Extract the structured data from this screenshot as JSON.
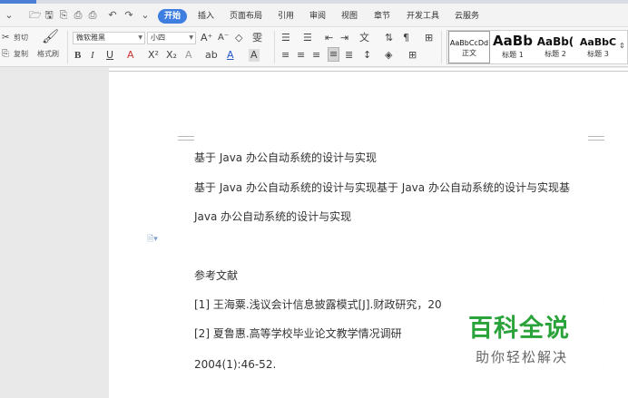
{
  "menubar": {
    "items": [
      "开始",
      "插入",
      "页面布局",
      "引用",
      "审阅",
      "视图",
      "章节",
      "开发工具",
      "云服务"
    ],
    "active_index": 0,
    "quick_icons": [
      "undo-dropdown-icon",
      "open-icon",
      "save-icon",
      "save-as-icon",
      "print-preview-icon",
      "print-icon",
      "undo-icon",
      "redo-icon",
      "customize-icon"
    ]
  },
  "ribbon": {
    "cut_label": "剪切",
    "copy_label": "复制",
    "format_painter_label": "格式刷",
    "font_name": "微软雅黑",
    "font_size": "小四",
    "bold": "B",
    "italic": "I",
    "underline": "U",
    "styles": [
      {
        "preview": "AaBbCcDd",
        "label": "正文"
      },
      {
        "preview": "AaBb",
        "label": "标题 1"
      },
      {
        "preview": "AaBb(",
        "label": "标题 2"
      },
      {
        "preview": "AaBbC",
        "label": "标题 3"
      }
    ]
  },
  "document": {
    "lines": [
      "基于 Java 办公自动系统的设计与实现",
      "基于 Java 办公自动系统的设计与实现基于 Java 办公自动系统的设计与实现基",
      "Java 办公自动系统的设计与实现",
      "参考文献",
      "[1]  王海粟.浅议会计信息披露模式[J].财政研究，20",
      "[2]  夏鲁惠.高等学校毕业论文教学情况调研",
      "2004(1):46-52."
    ]
  },
  "watermark": {
    "title": "百科全说",
    "subtitle": "助你轻松解决"
  },
  "colors": {
    "accent": "#3e7ee0",
    "watermark_green": "#2aa33a",
    "page": "#ffffff",
    "background": "#e9e9e9"
  }
}
